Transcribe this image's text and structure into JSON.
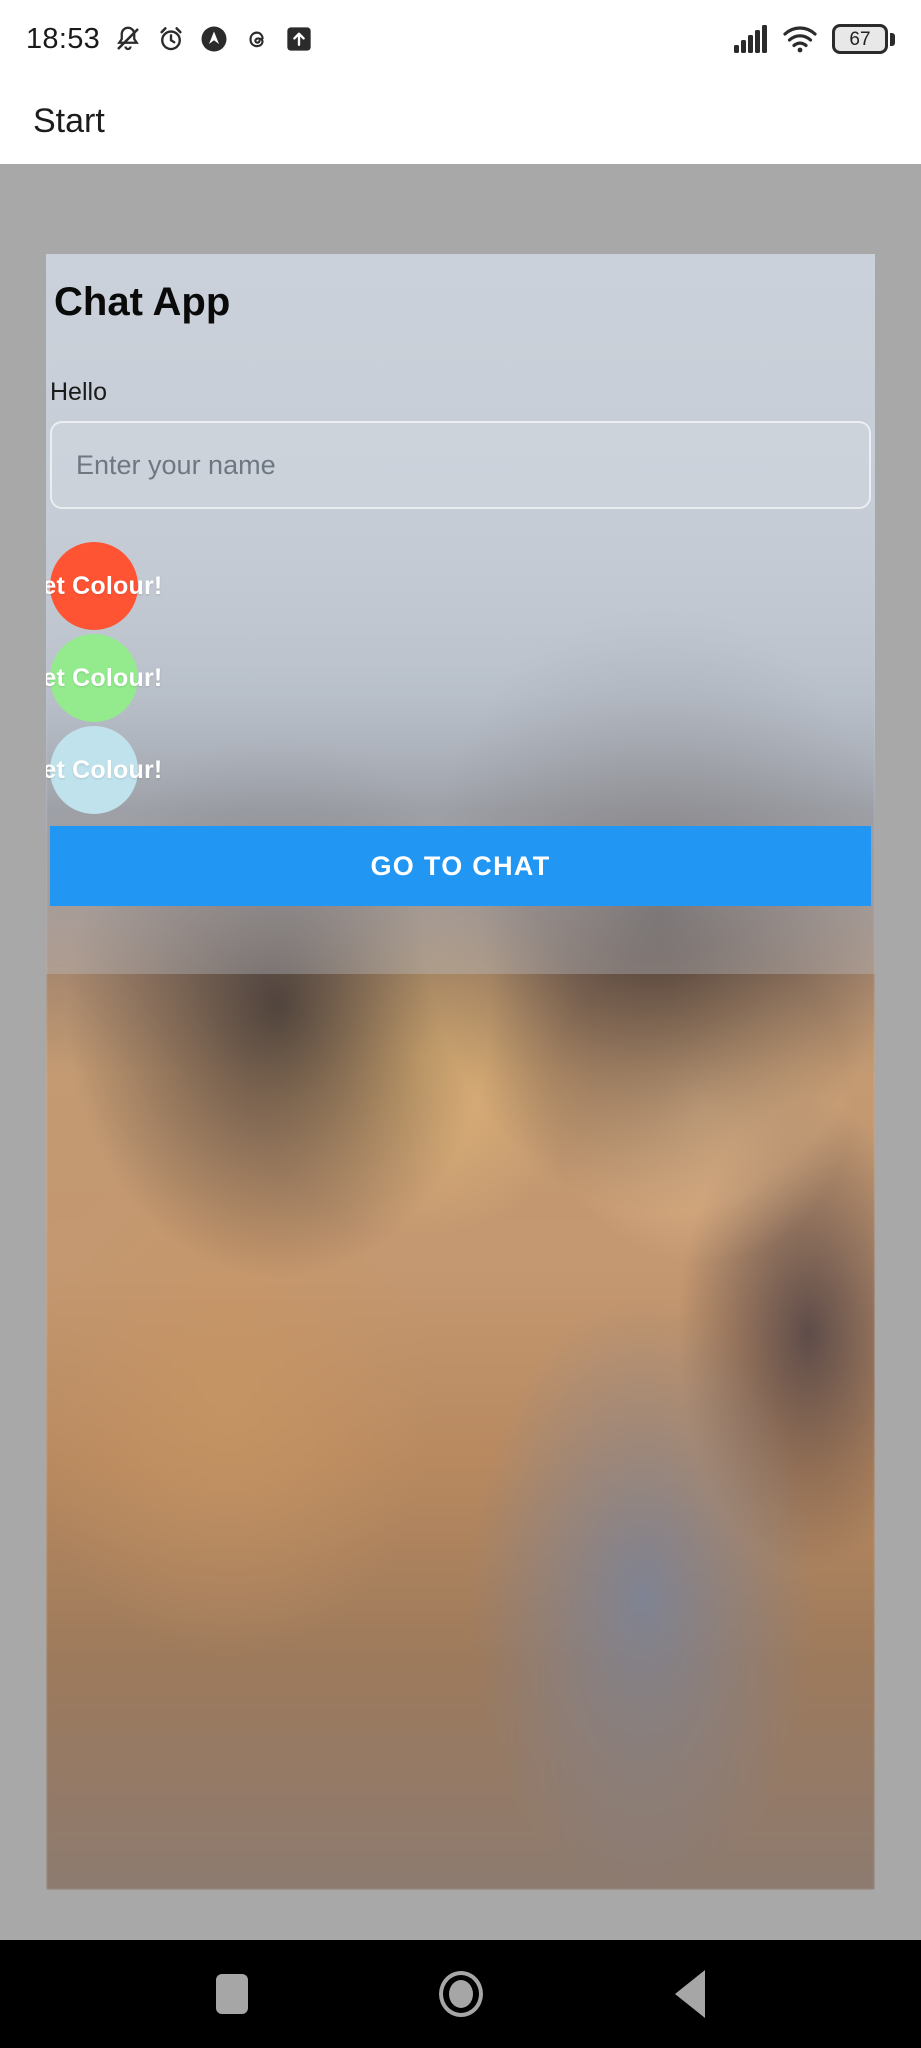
{
  "status_bar": {
    "time": "18:53",
    "battery_level": "67",
    "icons": [
      {
        "name": "bell-muted-icon"
      },
      {
        "name": "alarm-clock-icon"
      },
      {
        "name": "compass-badge-icon"
      },
      {
        "name": "threads-icon"
      },
      {
        "name": "upload-arrow-icon"
      }
    ],
    "right_icons": [
      {
        "name": "cellular-signal-icon"
      },
      {
        "name": "wifi-icon"
      },
      {
        "name": "battery-icon"
      }
    ]
  },
  "app_bar": {
    "title": "Start"
  },
  "card": {
    "title": "Chat App",
    "greeting_label": "Hello",
    "name_input": {
      "value": "",
      "placeholder": "Enter your name"
    },
    "colour_buttons": [
      {
        "label": "Set Colour!",
        "color": "#ff5433"
      },
      {
        "label": "Set Colour!",
        "color": "#93eb8e"
      },
      {
        "label": "Set Colour!",
        "color": "#bfe2ec"
      }
    ],
    "primary_button": {
      "label": "GO TO CHAT",
      "color": "#2196f3"
    }
  },
  "nav_bar": {
    "items": [
      {
        "name": "recents-button",
        "icon": "square-icon"
      },
      {
        "name": "home-button",
        "icon": "circle-icon"
      },
      {
        "name": "back-button",
        "icon": "triangle-left-icon"
      }
    ]
  },
  "colors": {
    "page_backdrop": "#a8a8a8",
    "app_bar_bg": "#ffffff",
    "nav_bar_bg": "#000000",
    "accent_blue": "#2196f3"
  }
}
